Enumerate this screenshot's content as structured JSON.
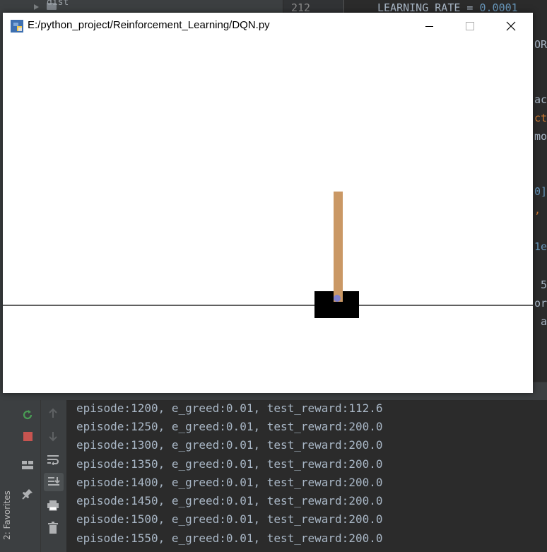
{
  "ide": {
    "tree_item": "dist",
    "line_number": "212",
    "code_top": {
      "name": "LEARNING_RATE",
      "op": " = ",
      "value": "0.0001"
    },
    "right_fragments": [
      {
        "text": "OR",
        "color": "#a9b7c6"
      },
      {
        "text": "ac",
        "color": "#a9b7c6"
      },
      {
        "text": "ct",
        "color": "#cc7832"
      },
      {
        "text": "mo",
        "color": "#a9b7c6"
      },
      {
        "text": "0]",
        "color": "#6897bb"
      },
      {
        "text": ",",
        "color": "#cc7832"
      },
      {
        "text": "1e",
        "color": "#6897bb"
      },
      {
        "text": " 5",
        "color": "#a9b7c6"
      },
      {
        "text": "or",
        "color": "#a9b7c6"
      },
      {
        "text": " a",
        "color": "#a9b7c6"
      }
    ],
    "favorites_label": "2: Favorites"
  },
  "run_panel": {
    "console_lines": [
      "episode:1200, e_greed:0.01, test_reward:112.6",
      "episode:1250, e_greed:0.01, test_reward:200.0",
      "episode:1300, e_greed:0.01, test_reward:200.0",
      "episode:1350, e_greed:0.01, test_reward:200.0",
      "episode:1400, e_greed:0.01, test_reward:200.0",
      "episode:1450, e_greed:0.01, test_reward:200.0",
      "episode:1500, e_greed:0.01, test_reward:200.0",
      "episode:1550, e_greed:0.01, test_reward:200.0"
    ],
    "toolbar_icons": [
      "rerun-icon",
      "stop-icon",
      "layout-icon",
      "pin-icon",
      "up-arrow-icon",
      "down-arrow-icon",
      "soft-wrap-icon",
      "scroll-to-end-icon",
      "print-icon",
      "trash-icon"
    ]
  },
  "gym_window": {
    "title": "E:/python_project/Reinforcement_Learning/DQN.py",
    "controls": {
      "minimize": "—",
      "maximize": "☐",
      "close": "✕"
    },
    "colors": {
      "cart": "#000000",
      "pole": "#ca9865",
      "axle": "#8080cc",
      "track": "#000000",
      "background": "#ffffff"
    }
  }
}
